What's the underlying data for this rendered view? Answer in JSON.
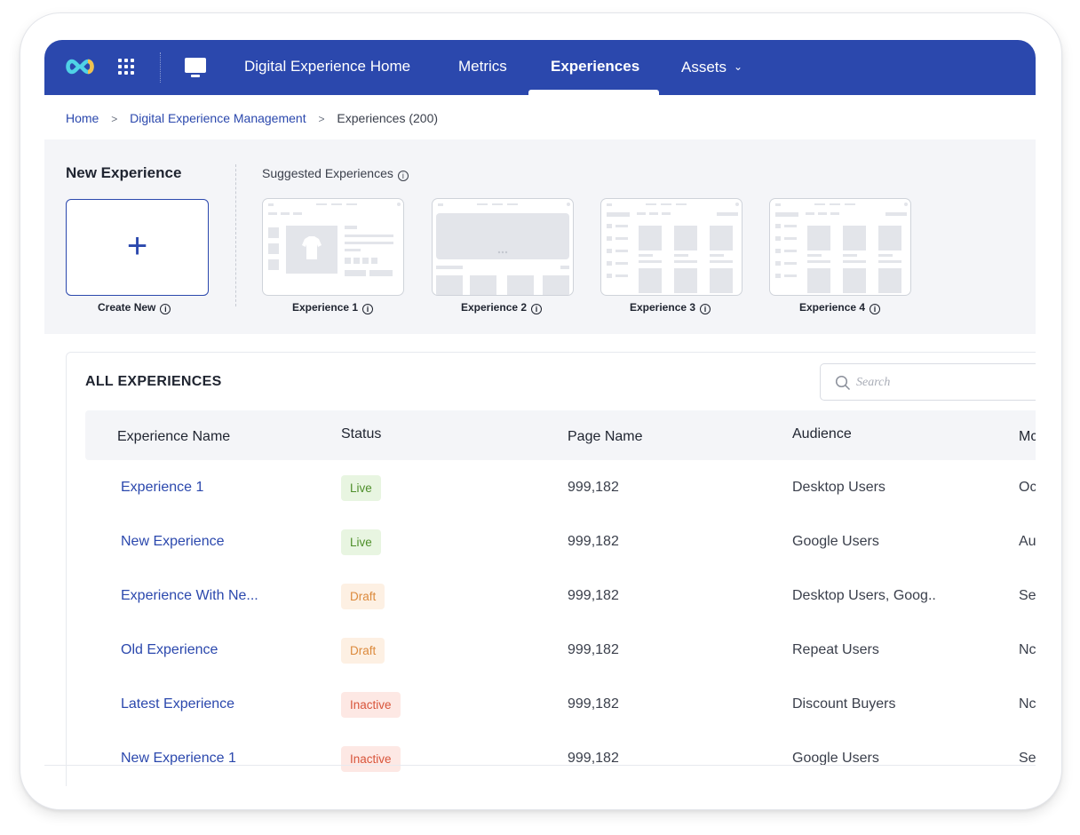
{
  "nav": {
    "items": [
      "Digital Experience Home",
      "Metrics",
      "Experiences",
      "Assets"
    ],
    "active": "Experiences"
  },
  "breadcrumb": {
    "home": "Home",
    "section": "Digital Experience Management",
    "current": "Experiences (200)"
  },
  "new_experience": {
    "title": "New Experience",
    "create_label": "Create New"
  },
  "suggested": {
    "title": "Suggested Experiences",
    "cards": [
      "Experience 1",
      "Experience 2",
      "Experience 3",
      "Experience 4"
    ]
  },
  "table": {
    "title": "ALL EXPERIENCES",
    "search_placeholder": "Search",
    "columns": [
      "Experience Name",
      "Status",
      "Page Name",
      "Audience",
      "Mc"
    ],
    "rows": [
      {
        "name": "Experience 1",
        "status": "Live",
        "page": "999,182",
        "audience": "Desktop Users",
        "modified": "Oc"
      },
      {
        "name": "New Experience",
        "status": "Live",
        "page": "999,182",
        "audience": "Google Users",
        "modified": "Au"
      },
      {
        "name": "Experience With Ne...",
        "status": "Draft",
        "page": "999,182",
        "audience": "Desktop Users, Goog..",
        "modified": "Se"
      },
      {
        "name": "Old Experience",
        "status": "Draft",
        "page": "999,182",
        "audience": "Repeat Users",
        "modified": "Nc"
      },
      {
        "name": "Latest Experience",
        "status": "Inactive",
        "page": "999,182",
        "audience": "Discount Buyers",
        "modified": "Nc"
      },
      {
        "name": "New Experience 1",
        "status": "Inactive",
        "page": "999,182",
        "audience": "Google Users",
        "modified": "Se"
      }
    ]
  },
  "colors": {
    "brand": "#2b48ad",
    "live": "#4e8f2a",
    "draft": "#dc8a3c",
    "inactive": "#d8543a"
  }
}
